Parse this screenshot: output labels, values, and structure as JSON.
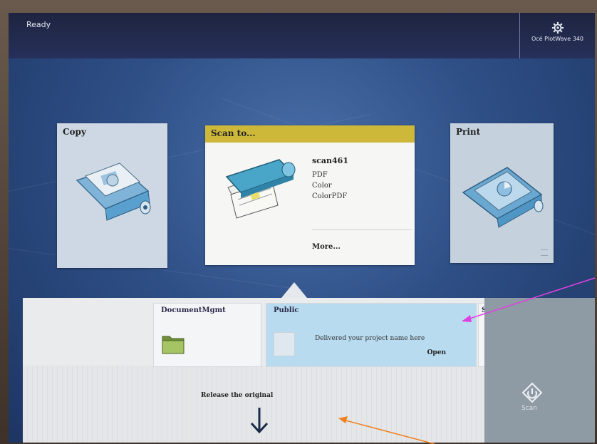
{
  "header": {
    "status": "Ready",
    "device_name": "Océ PlotWave 340"
  },
  "cards": {
    "copy": {
      "title": "Copy"
    },
    "scan": {
      "title": "Scan to...",
      "preset_name": "scan461",
      "settings": [
        "PDF",
        "Color",
        "ColorPDF"
      ],
      "more_label": "More..."
    },
    "print": {
      "title": "Print"
    }
  },
  "destinations": [
    {
      "name": "DocumentMgmt"
    },
    {
      "name": "Public",
      "description": "Delivered your project name here",
      "action": "Open"
    },
    {
      "name": "S"
    }
  ],
  "release_label": "Release the original",
  "scan_button": {
    "label": "Scan"
  },
  "colors": {
    "scan_header": "#cdb83a",
    "selected_destination": "#b8dbef",
    "annotation_magenta": "#e040e0",
    "annotation_orange": "#f08020"
  }
}
